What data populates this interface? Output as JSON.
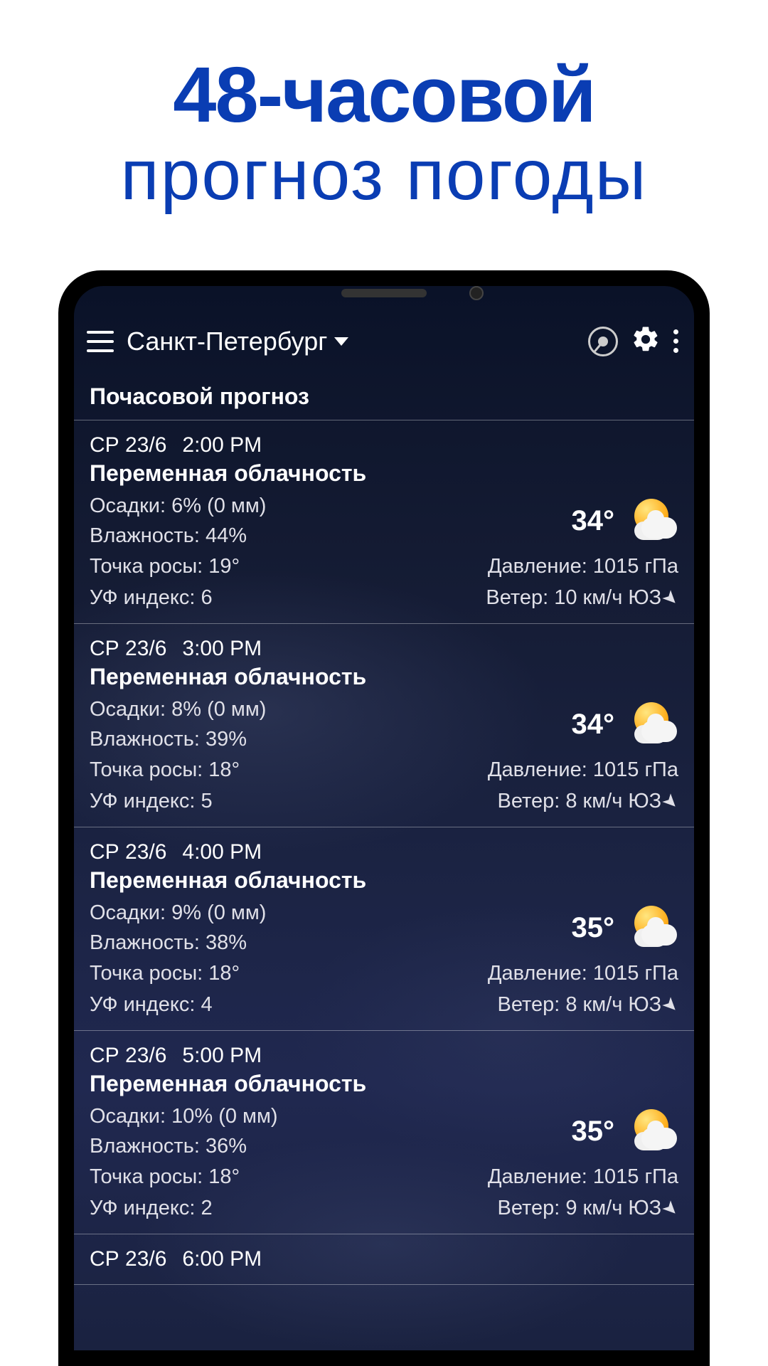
{
  "promo": {
    "line1": "48-часовой",
    "line2": "прогноз погоды"
  },
  "header": {
    "city": "Санкт-Петербург"
  },
  "section_title": "Почасовой прогноз",
  "labels": {
    "precip": "Осадки",
    "humidity": "Влажность",
    "dewpoint": "Точка росы",
    "uv": "УФ индекс",
    "pressure": "Давление",
    "wind": "Ветер"
  },
  "hours": [
    {
      "day": "СР 23/6",
      "time": "2:00 PM",
      "condition": "Переменная облачность",
      "precip": "6% (0 мм)",
      "humidity": "44%",
      "dewpoint": "19°",
      "uv": "6",
      "temp": "34°",
      "pressure": "1015 гПа",
      "wind": "10 км/ч ЮЗ"
    },
    {
      "day": "СР 23/6",
      "time": "3:00 PM",
      "condition": "Переменная облачность",
      "precip": "8% (0 мм)",
      "humidity": "39%",
      "dewpoint": "18°",
      "uv": "5",
      "temp": "34°",
      "pressure": "1015 гПа",
      "wind": "8 км/ч ЮЗ"
    },
    {
      "day": "СР 23/6",
      "time": "4:00 PM",
      "condition": "Переменная облачность",
      "precip": "9% (0 мм)",
      "humidity": "38%",
      "dewpoint": "18°",
      "uv": "4",
      "temp": "35°",
      "pressure": "1015 гПа",
      "wind": "8 км/ч ЮЗ"
    },
    {
      "day": "СР 23/6",
      "time": "5:00 PM",
      "condition": "Переменная облачность",
      "precip": "10% (0 мм)",
      "humidity": "36%",
      "dewpoint": "18°",
      "uv": "2",
      "temp": "35°",
      "pressure": "1015 гПа",
      "wind": "9 км/ч ЮЗ"
    },
    {
      "day": "СР 23/6",
      "time": "6:00 PM",
      "condition": "",
      "precip": "",
      "humidity": "",
      "dewpoint": "",
      "uv": "",
      "temp": "",
      "pressure": "",
      "wind": ""
    }
  ]
}
